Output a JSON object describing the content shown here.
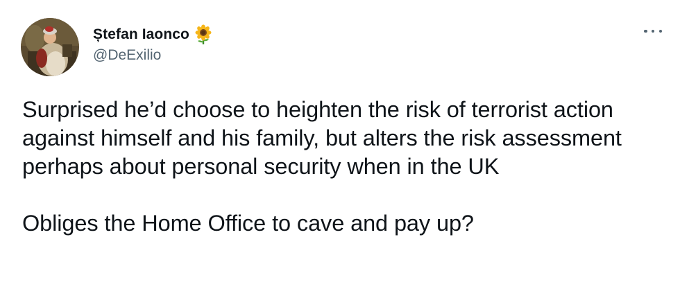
{
  "author": {
    "display_name": "Ștefan Iaonco",
    "handle": "@DeExilio",
    "name_emoji": "sunflower-icon"
  },
  "tweet": {
    "paragraph_1": "Surprised he’d choose to heighten the risk of terrorist action against himself and his family, but alters the risk assessment perhaps about personal security when in the UK",
    "paragraph_2": "Obliges the Home Office to cave and pay up?"
  },
  "colors": {
    "text_primary": "#0f1419",
    "text_secondary": "#536471",
    "background": "#ffffff"
  },
  "icons": {
    "more": "more-options-icon",
    "avatar": "avatar"
  }
}
